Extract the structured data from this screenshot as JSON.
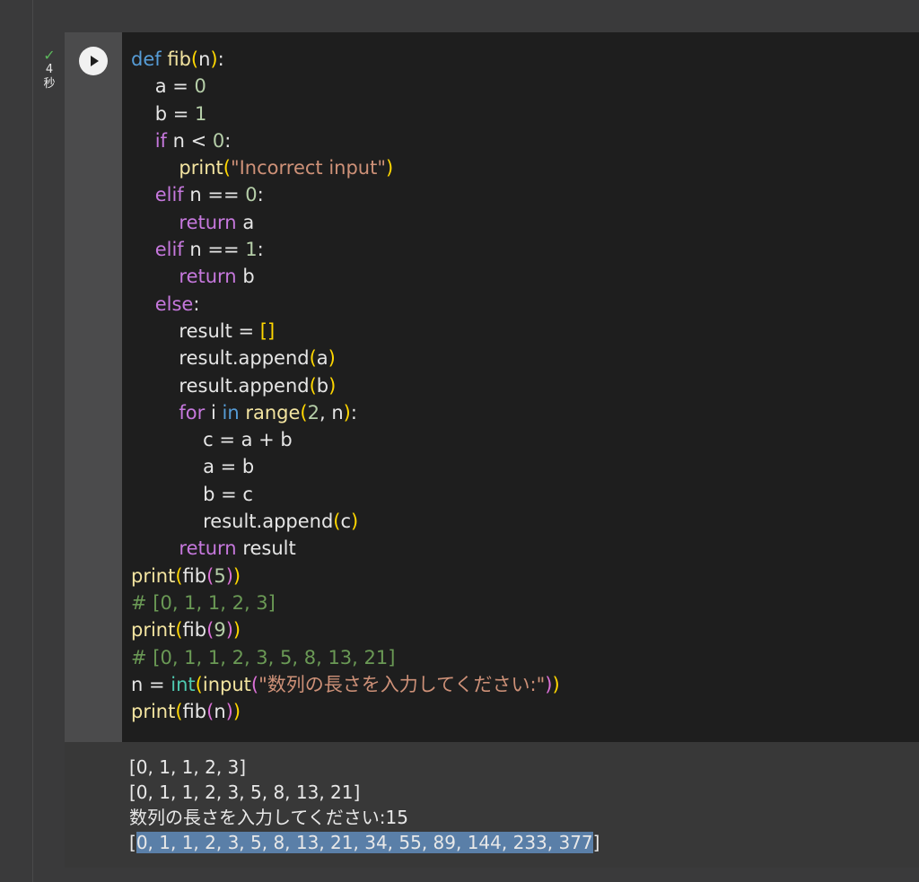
{
  "execution": {
    "duration_value": "4",
    "duration_unit": "秒"
  },
  "code": {
    "line1": {
      "kw": "def",
      "name": "fib",
      "param": "n"
    },
    "line2": {
      "var": "a",
      "val": "0"
    },
    "line3": {
      "var": "b",
      "val": "1"
    },
    "line4": {
      "kw": "if",
      "var": "n",
      "op": "<",
      "val": "0"
    },
    "line5": {
      "fn": "print",
      "str": "\"Incorrect input\""
    },
    "line6": {
      "kw": "elif",
      "var": "n",
      "op": "==",
      "val": "0"
    },
    "line7": {
      "kw": "return",
      "var": "a"
    },
    "line8": {
      "kw": "elif",
      "var": "n",
      "op": "==",
      "val": "1"
    },
    "line9": {
      "kw": "return",
      "var": "b"
    },
    "line10": {
      "kw": "else"
    },
    "line11": {
      "var": "result",
      "val": "[]"
    },
    "line12": {
      "method": "result.append",
      "arg": "a"
    },
    "line13": {
      "method": "result.append",
      "arg": "b"
    },
    "line14": {
      "kw_for": "for",
      "var": "i",
      "kw_in": "in",
      "fn": "range",
      "start": "2",
      "end": "n"
    },
    "line15": {
      "text": "c = a + b"
    },
    "line16": {
      "text": "a = b"
    },
    "line17": {
      "text": "b = c"
    },
    "line18": {
      "method": "result.append",
      "arg": "c"
    },
    "line19": {
      "kw": "return",
      "var": "result"
    },
    "line20": {
      "outer": "print",
      "inner": "fib",
      "arg": "5"
    },
    "line21": {
      "comment": "# [0, 1, 1, 2, 3]"
    },
    "line22": {
      "outer": "print",
      "inner": "fib",
      "arg": "9"
    },
    "line23": {
      "comment": "# [0, 1, 1, 2, 3, 5, 8, 13, 21]"
    },
    "line24": {
      "var": "n",
      "bt": "int",
      "fn": "input",
      "str": "\"数列の長さを入力してください:\""
    },
    "line25": {
      "outer": "print",
      "inner": "fib",
      "arg": "n"
    }
  },
  "output": {
    "line1": "[0, 1, 1, 2, 3]",
    "line2": "[0, 1, 1, 2, 3, 5, 8, 13, 21]",
    "line3": "数列の長さを入力してください:15",
    "line4_open": "[",
    "line4_selected": "0, 1, 1, 2, 3, 5, 8, 13, 21, 34, 55, 89, 144, 233, 377",
    "line4_close": "]"
  }
}
